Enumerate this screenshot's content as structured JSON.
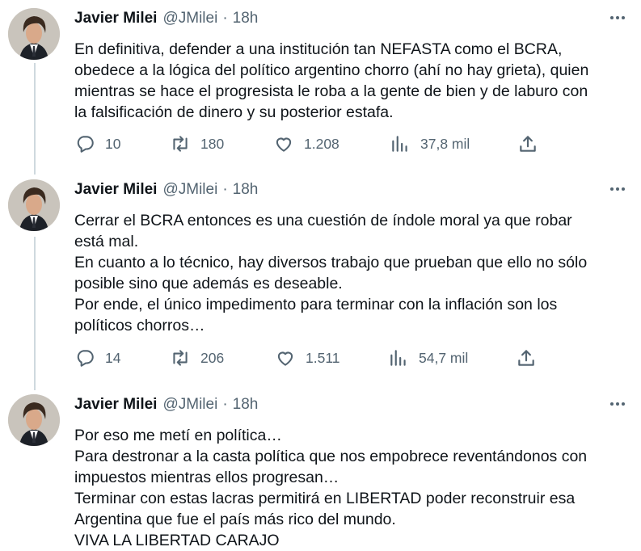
{
  "tweets": [
    {
      "author": "Javier Milei",
      "handle": "@JMilei",
      "time": "18h",
      "lines": [
        "En definitiva, defender a una institución tan NEFASTA como el BCRA,",
        "obedece a la lógica del político argentino chorro (ahí no hay grieta), quien",
        "mientras se hace el progresista le roba a la gente de bien y de laburo con",
        "la falsificación de dinero y su posterior estafa."
      ],
      "replies": "10",
      "retweets": "180",
      "likes": "1.208",
      "views": "37,8 mil"
    },
    {
      "author": "Javier Milei",
      "handle": "@JMilei",
      "time": "18h",
      "lines": [
        "Cerrar el BCRA entonces es una cuestión de índole moral ya que robar",
        "está mal.",
        "En cuanto a lo técnico, hay diversos trabajo que prueban que ello no sólo",
        "posible sino que además es deseable.",
        "Por ende, el único impedimento para terminar con la inflación son los",
        "políticos chorros…"
      ],
      "replies": "14",
      "retweets": "206",
      "likes": "1.511",
      "views": "54,7 mil"
    },
    {
      "author": "Javier Milei",
      "handle": "@JMilei",
      "time": "18h",
      "lines": [
        "Por eso me metí en política…",
        "Para destronar a la casta política que nos empobrece reventándonos con",
        "impuestos mientras ellos progresan…",
        "Terminar con estas lacras permitirá en LIBERTAD poder reconstruir esa",
        "Argentina que fue el país más rico del mundo.",
        "VIVA LA LIBERTAD CARAJO"
      ]
    }
  ],
  "icons": {
    "reply": "reply-icon",
    "retweet": "retweet-icon",
    "like": "heart-icon",
    "views": "views-icon",
    "share": "share-icon",
    "more": "more-icon"
  },
  "colors": {
    "text": "#0f1419",
    "secondary": "#536471",
    "thread_line": "#cfd9de"
  }
}
